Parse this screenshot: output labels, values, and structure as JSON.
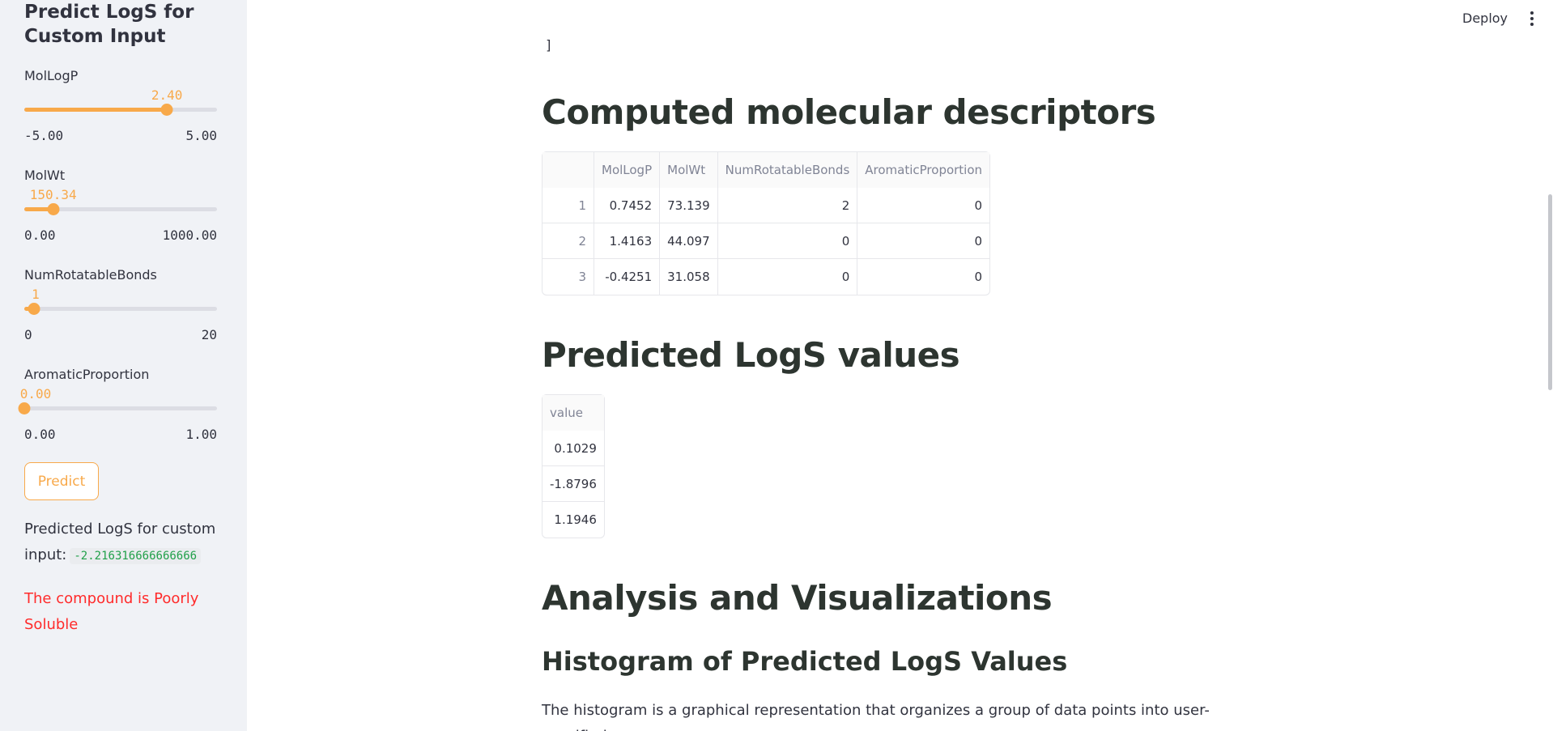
{
  "sidebar": {
    "title": "Predict LogS for Custom Input",
    "sliders": [
      {
        "label": "MolLogP",
        "value": "2.40",
        "min": "-5.00",
        "max": "5.00",
        "fraction": 0.74
      },
      {
        "label": "MolWt",
        "value": "150.34",
        "min": "0.00",
        "max": "1000.00",
        "fraction": 0.15
      },
      {
        "label": "NumRotatableBonds",
        "value": "1",
        "min": "0",
        "max": "20",
        "fraction": 0.05
      },
      {
        "label": "AromaticProportion",
        "value": "0.00",
        "min": "0.00",
        "max": "1.00",
        "fraction": 0.0
      }
    ],
    "predict_label": "Predict",
    "prediction_label": "Predicted LogS for custom input:",
    "prediction_value": "-2.216316666666666",
    "solubility_text": "The compound is Poorly Soluble"
  },
  "header": {
    "deploy_label": "Deploy"
  },
  "main": {
    "bracket": "]",
    "descriptors_title": "Computed molecular descriptors",
    "descriptors_table": {
      "columns": [
        "",
        "MolLogP",
        "MolWt",
        "NumRotatableBonds",
        "AromaticProportion"
      ],
      "rows": [
        [
          "1",
          "0.7452",
          "73.139",
          "2",
          "0"
        ],
        [
          "2",
          "1.4163",
          "44.097",
          "0",
          "0"
        ],
        [
          "3",
          "-0.4251",
          "31.058",
          "0",
          "0"
        ]
      ]
    },
    "predicted_title": "Predicted LogS values",
    "predicted_table": {
      "columns": [
        "value"
      ],
      "rows": [
        [
          "0.1029"
        ],
        [
          "-1.8796"
        ],
        [
          "1.1946"
        ]
      ]
    },
    "analysis_title": "Analysis and Visualizations",
    "histogram_title": "Histogram of Predicted LogS Values",
    "histogram_text": "The histogram is a graphical representation that organizes a group of data points into user-specified"
  },
  "colors": {
    "accent": "#f8a94a",
    "success": "#21a04a",
    "error": "#ff2b2b",
    "sidebar_bg": "#f0f2f6"
  },
  "icons": {
    "menu": "kebab-menu-icon"
  }
}
